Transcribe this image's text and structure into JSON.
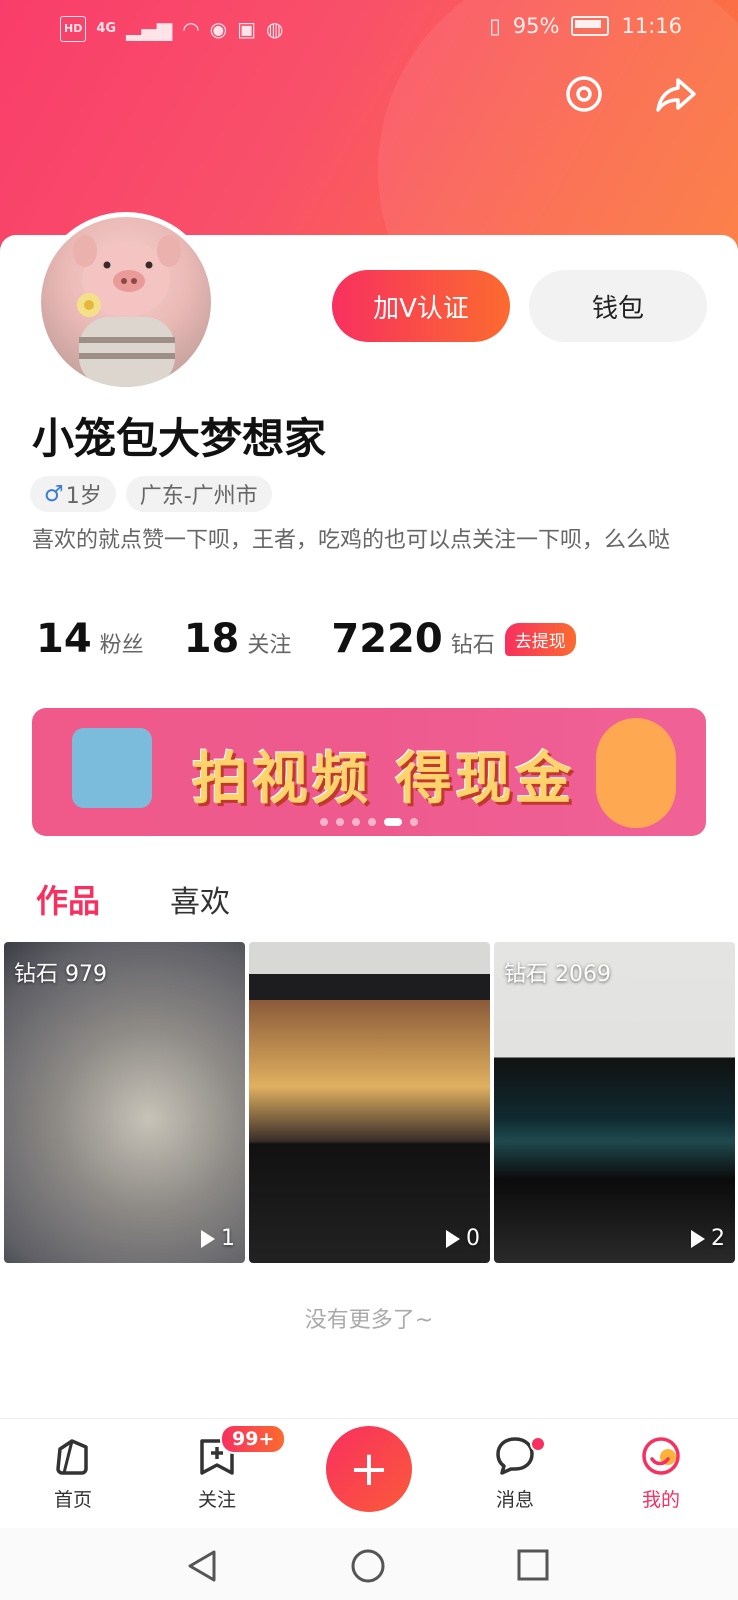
{
  "status_bar": {
    "hd": "HD",
    "network": "4G",
    "battery": "95%",
    "time": "11:16"
  },
  "profile": {
    "username": "小笼包大梦想家",
    "gender_symbol": "♂",
    "age": "1岁",
    "location": "广东-广州市",
    "bio": "喜欢的就点赞一下呗，王者，吃鸡的也可以点关注一下呗，么么哒",
    "verify_button": "加V认证",
    "wallet_button": "钱包"
  },
  "stats": {
    "fans_num": "14",
    "fans_label": "粉丝",
    "follow_num": "18",
    "follow_label": "关注",
    "diamond_num": "7220",
    "diamond_label": "钻石",
    "withdraw": "去提现"
  },
  "banner": {
    "text": "拍视频 得现金",
    "dots": 6,
    "active_dot": 4
  },
  "tabs": [
    {
      "label": "作品",
      "active": true
    },
    {
      "label": "喜欢",
      "active": false
    }
  ],
  "videos": [
    {
      "diamond": "钻石 979",
      "plays": "1"
    },
    {
      "diamond": "",
      "plays": "0"
    },
    {
      "diamond": "钻石 2069",
      "plays": "2"
    }
  ],
  "no_more": "没有更多了~",
  "bottom_nav": {
    "home": "首页",
    "follow": "关注",
    "follow_badge": "99+",
    "messages": "消息",
    "mine": "我的"
  },
  "colors": {
    "accent": "#f8305f",
    "accent2": "#fb6b2f"
  }
}
